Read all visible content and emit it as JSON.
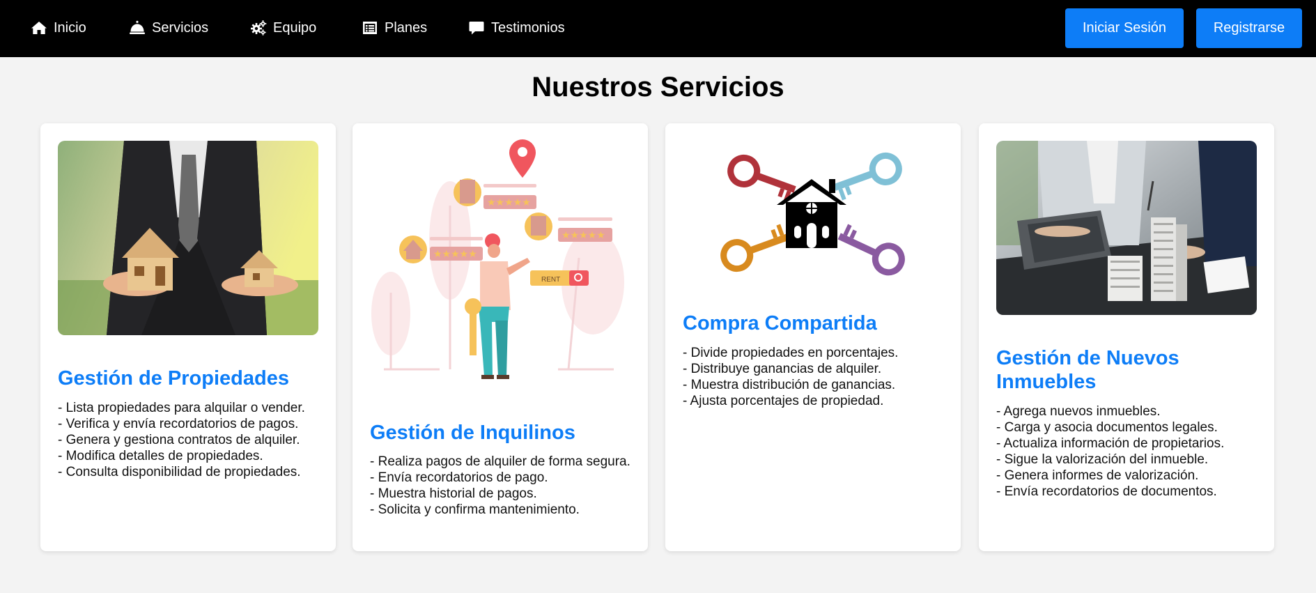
{
  "nav": {
    "items": [
      {
        "label": "Inicio",
        "icon": "home-icon"
      },
      {
        "label": "Servicios",
        "icon": "service-bell-icon"
      },
      {
        "label": "Equipo",
        "icon": "gears-icon"
      },
      {
        "label": "Planes",
        "icon": "list-alt-icon"
      },
      {
        "label": "Testimonios",
        "icon": "comment-icon"
      }
    ],
    "login_label": "Iniciar Sesión",
    "register_label": "Registrarse"
  },
  "page": {
    "title": "Nuestros Servicios"
  },
  "colors": {
    "accent": "#0d7df7",
    "navbar": "#000000",
    "background": "#f3f3f3"
  },
  "cards": [
    {
      "title": "Gestión de Propiedades",
      "image": "businessman-holding-houses-photo",
      "items": [
        "- Lista propiedades para alquilar o vender.",
        "- Verifica y envía recordatorios de pagos.",
        "- Genera y gestiona contratos de alquiler.",
        "- Modifica detalles de propiedades.",
        "- Consulta disponibilidad de propiedades."
      ]
    },
    {
      "title": "Gestión de Inquilinos",
      "image": "rent-search-illustration",
      "rent_tag": "RENT",
      "items": [
        "- Realiza pagos de alquiler de forma segura.",
        "- Envía recordatorios de pago.",
        "- Muestra historial de pagos.",
        "- Solicita y confirma mantenimiento."
      ]
    },
    {
      "title": "Compra Compartida",
      "image": "keys-around-house-illustration",
      "items": [
        "- Divide propiedades en porcentajes.",
        "- Distribuye ganancias de alquiler.",
        "- Muestra distribución de ganancias.",
        "- Ajusta porcentajes de propiedad."
      ]
    },
    {
      "title": "Gestión de Nuevos Inmuebles",
      "image": "building-model-meeting-photo",
      "items": [
        "- Agrega nuevos inmuebles.",
        "- Carga y asocia documentos legales.",
        "- Actualiza información de propietarios.",
        "- Sigue la valorización del inmueble.",
        "- Genera informes de valorización.",
        "- Envía recordatorios de documentos."
      ]
    }
  ]
}
